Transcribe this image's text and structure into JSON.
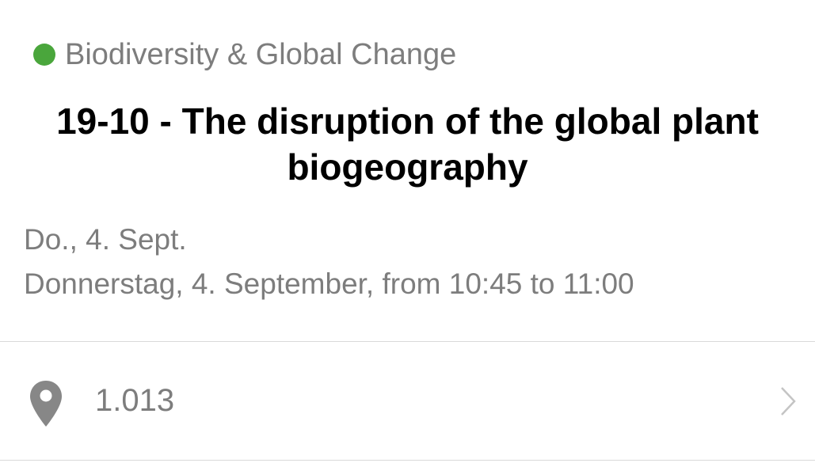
{
  "session": {
    "track": {
      "label": "Biodiversity & Global Change",
      "color": "#4aa63c"
    },
    "title": "19-10 - The disruption of the global plant biogeography",
    "date_short": "Do., 4. Sept.",
    "date_long": "Donnerstag, 4. September, from 10:45 to 11:00",
    "location": {
      "room": "1.013",
      "icon": "map-pin-icon",
      "chevron": "chevron-right-icon"
    }
  }
}
